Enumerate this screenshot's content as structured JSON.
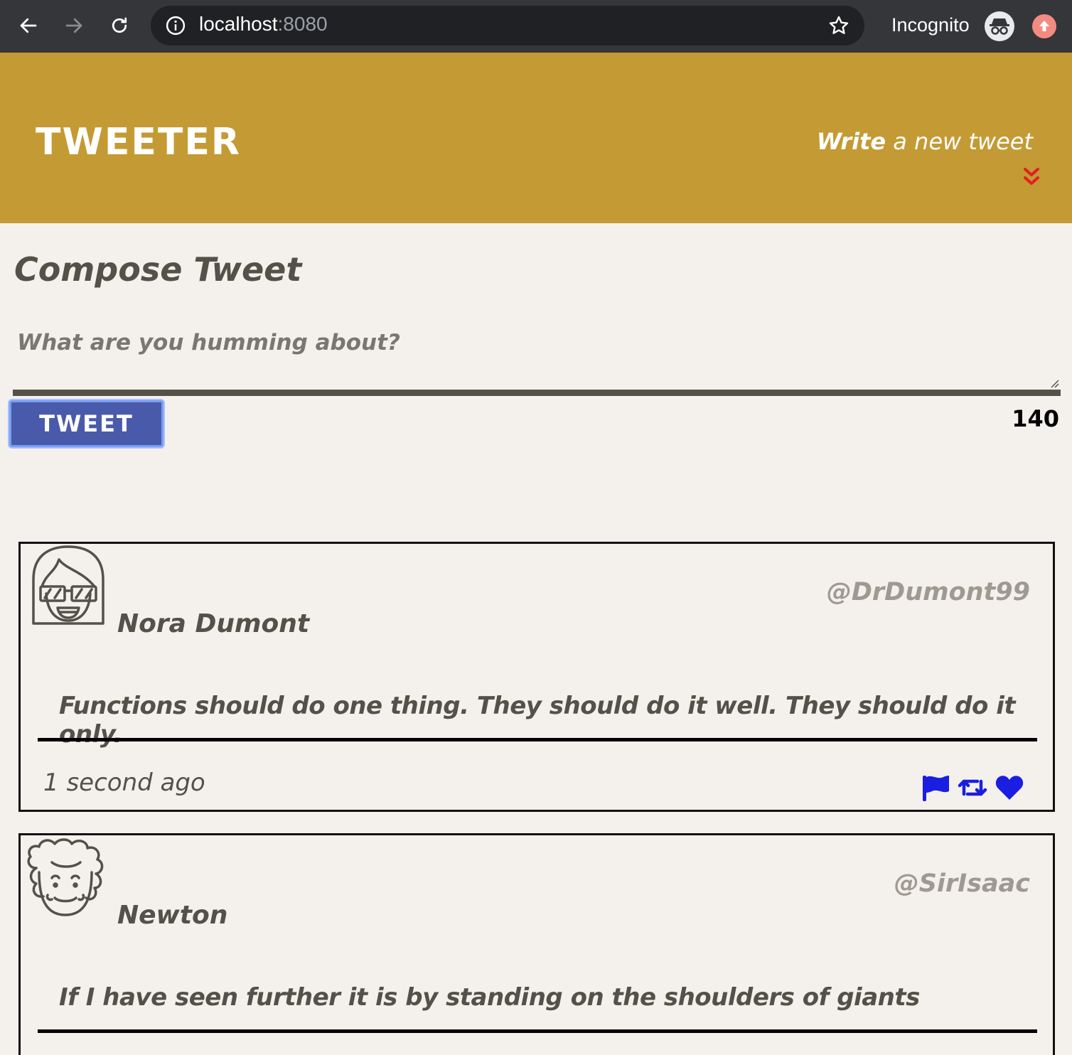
{
  "browser": {
    "url_host": "localhost",
    "url_port": ":8080",
    "mode_label": "Incognito"
  },
  "header": {
    "brand": "TWEETER",
    "write_emphasis": "Write",
    "write_rest": " a new tweet"
  },
  "compose": {
    "title": "Compose Tweet",
    "placeholder": "What are you humming about?",
    "button_label": "TWEET",
    "counter": "140"
  },
  "tweets": [
    {
      "name": "Nora Dumont",
      "handle": "@DrDumont99",
      "content": "Functions should do one thing. They should do it well. They should do it only.",
      "time": "1 second ago",
      "avatar": "avatar-glasses-icon"
    },
    {
      "name": "Newton",
      "handle": "@SirIsaac",
      "content": "If I have seen further it is by standing on the shoulders of giants",
      "time": "",
      "avatar": "avatar-curly-icon"
    }
  ],
  "colors": {
    "header_bg": "#c49a34",
    "page_bg": "#f4f1ec",
    "text": "#545149",
    "handle": "#9e9a92",
    "button_bg": "#4a5aab",
    "action_icons": "#1a1ee0",
    "chevron": "#e02020"
  }
}
